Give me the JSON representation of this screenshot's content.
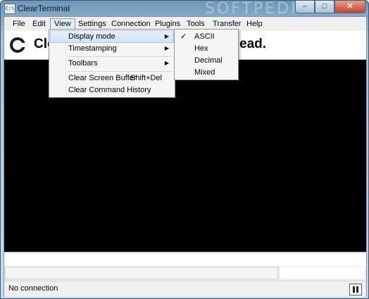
{
  "window": {
    "title": "ClearTerminal",
    "app_icon_text": "C:\\",
    "watermark": "SOFTPEDIA"
  },
  "caption_buttons": {
    "minimize": "–",
    "maximize": "□",
    "close": "✕"
  },
  "menubar": {
    "items": [
      {
        "label": "File"
      },
      {
        "label": "Edit"
      },
      {
        "label": "View"
      },
      {
        "label": "Settings"
      },
      {
        "label": "Connection"
      },
      {
        "label": "Plugins"
      },
      {
        "label": "Tools"
      },
      {
        "label": "Transfer"
      },
      {
        "label": "Help"
      }
    ],
    "active": "View"
  },
  "banner": {
    "text_start": "Cle",
    "text_end": "ead."
  },
  "view_menu": {
    "items": [
      {
        "label": "Display mode",
        "submenu": true,
        "highlighted": true
      },
      {
        "label": "Timestamping",
        "submenu": true
      },
      {
        "label": "Toolbars",
        "submenu": true
      },
      {
        "label": "Clear Screen Buffer",
        "shortcut": "Shift+Del"
      },
      {
        "label": "Clear Command History"
      }
    ]
  },
  "display_mode_menu": {
    "items": [
      {
        "label": "ASCII",
        "checked": true
      },
      {
        "label": "Hex"
      },
      {
        "label": "Decimal"
      },
      {
        "label": "Mixed"
      }
    ],
    "check_glyph": "✓"
  },
  "submenu_arrow": "▶",
  "status": {
    "text": "No connection",
    "pause_icon": "pause-icon"
  },
  "colors": {
    "terminal_bg": "#000000",
    "menu_highlight": "#d2e3f5"
  }
}
